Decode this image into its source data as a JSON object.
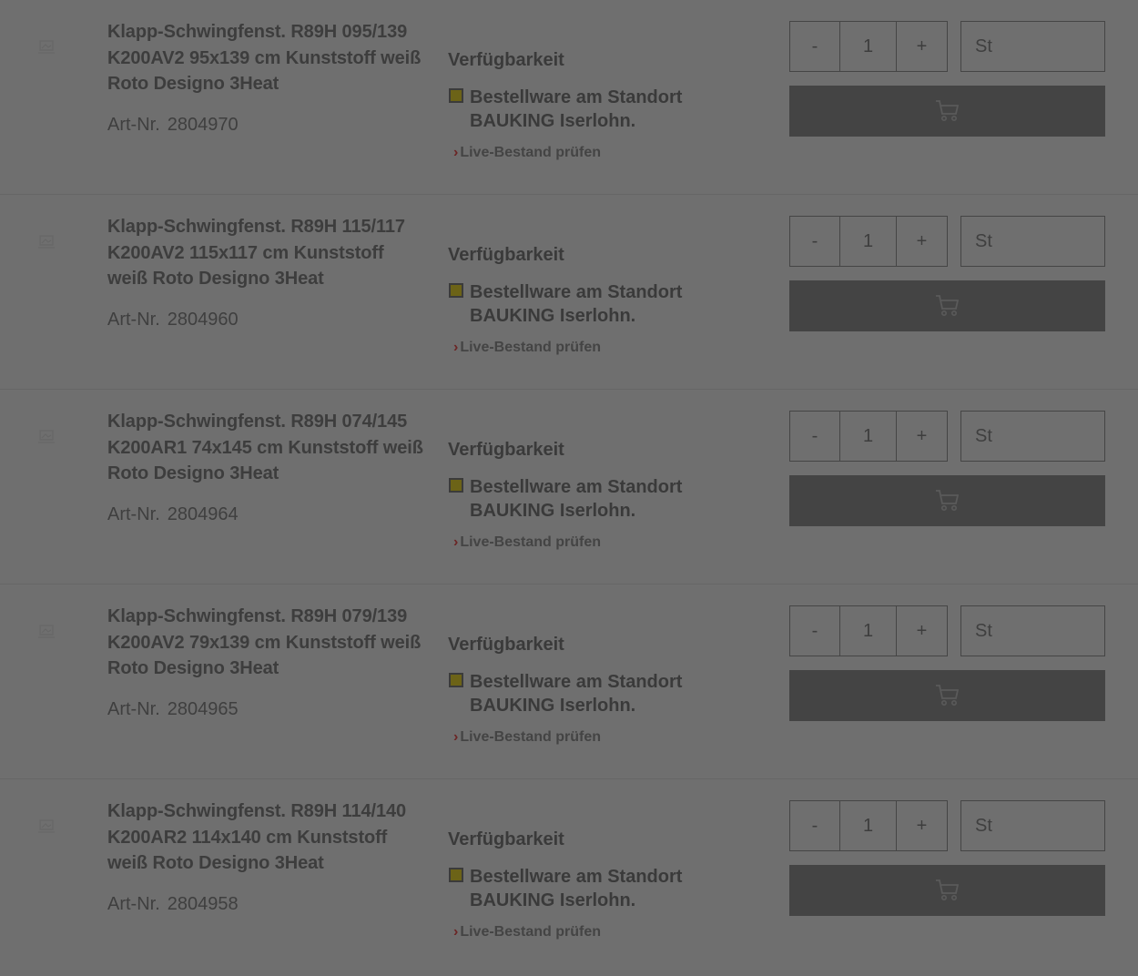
{
  "labels": {
    "availability": "Verfügbarkeit",
    "art_nr": "Art-Nr.",
    "live_check": "Live-Bestand prüfen",
    "minus": "-",
    "plus": "+"
  },
  "icons": {
    "thumbnail": "image-placeholder-icon",
    "cart": "shopping-cart-icon",
    "chevron": "chevron-right-icon"
  },
  "colors": {
    "status_indicator": "#6c6317",
    "link_chevron": "#6b2525",
    "cart_button": "#444444"
  },
  "products": [
    {
      "title": "Klapp-Schwingfenst. R89H 095/139 K200AV2 95x139 cm Kunststoff weiß Roto Designo 3Heat",
      "art_nr": "2804970",
      "status": "Bestellware am Standort BAUKING Iserlohn.",
      "quantity": "1",
      "unit": "St"
    },
    {
      "title": "Klapp-Schwingfenst. R89H 115/117 K200AV2 115x117 cm Kunststoff weiß Roto Designo 3Heat",
      "art_nr": "2804960",
      "status": "Bestellware am Standort BAUKING Iserlohn.",
      "quantity": "1",
      "unit": "St"
    },
    {
      "title": "Klapp-Schwingfenst. R89H 074/145 K200AR1 74x145 cm Kunststoff weiß Roto Designo 3Heat",
      "art_nr": "2804964",
      "status": "Bestellware am Standort BAUKING Iserlohn.",
      "quantity": "1",
      "unit": "St"
    },
    {
      "title": "Klapp-Schwingfenst. R89H 079/139 K200AV2 79x139 cm Kunststoff weiß Roto Designo 3Heat",
      "art_nr": "2804965",
      "status": "Bestellware am Standort BAUKING Iserlohn.",
      "quantity": "1",
      "unit": "St"
    },
    {
      "title": "Klapp-Schwingfenst. R89H 114/140 K200AR2 114x140 cm Kunststoff weiß Roto Designo 3Heat",
      "art_nr": "2804958",
      "status": "Bestellware am Standort BAUKING Iserlohn.",
      "quantity": "1",
      "unit": "St"
    }
  ]
}
